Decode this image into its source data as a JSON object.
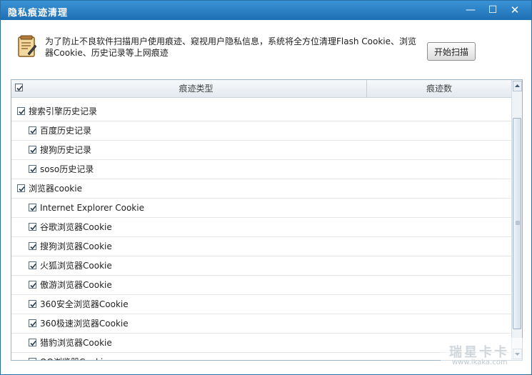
{
  "window": {
    "title": "隐私痕迹清理",
    "minimize_glyph": "—",
    "maximize_glyph": "☐",
    "close_glyph": "✕"
  },
  "notice": {
    "icon": "notepad-icon",
    "text": "为了防止不良软件扫描用户使用痕迹、窥视用户隐私信息，系统将全方位清理Flash Cookie、浏览器Cookie、历史记录等上网痕迹",
    "scan_button": "开始扫描"
  },
  "table": {
    "header_checked": true,
    "col_type": "痕迹类型",
    "col_count": "痕迹数",
    "rows": [
      {
        "label": "搜索引擎历史记录",
        "level": "group",
        "checked": true
      },
      {
        "label": "百度历史记录",
        "level": "child",
        "checked": true
      },
      {
        "label": "搜狗历史记录",
        "level": "child",
        "checked": true
      },
      {
        "label": "soso历史记录",
        "level": "child",
        "checked": true
      },
      {
        "label": "浏览器cookie",
        "level": "group",
        "checked": true
      },
      {
        "label": "Internet Explorer Cookie",
        "level": "child",
        "checked": true
      },
      {
        "label": "谷歌浏览器Cookie",
        "level": "child",
        "checked": true
      },
      {
        "label": "搜狗浏览器Cookie",
        "level": "child",
        "checked": true
      },
      {
        "label": "火狐浏览器Cookie",
        "level": "child",
        "checked": true
      },
      {
        "label": "傲游浏览器Cookie",
        "level": "child",
        "checked": true
      },
      {
        "label": "360安全浏览器Cookie",
        "level": "child",
        "checked": true
      },
      {
        "label": "360极速浏览器Cookie",
        "level": "child",
        "checked": true
      },
      {
        "label": "猎豹浏览器Cookie",
        "level": "child",
        "checked": true
      },
      {
        "label": "QQ浏览器Cookie",
        "level": "child",
        "checked": true
      }
    ]
  },
  "watermark": {
    "main": "瑞星卡卡",
    "sub": "www.ikaka.com"
  },
  "colors": {
    "titlebar": "#1e6fb3",
    "border": "#9cb3c6",
    "checkmark": "#2b3a48"
  }
}
